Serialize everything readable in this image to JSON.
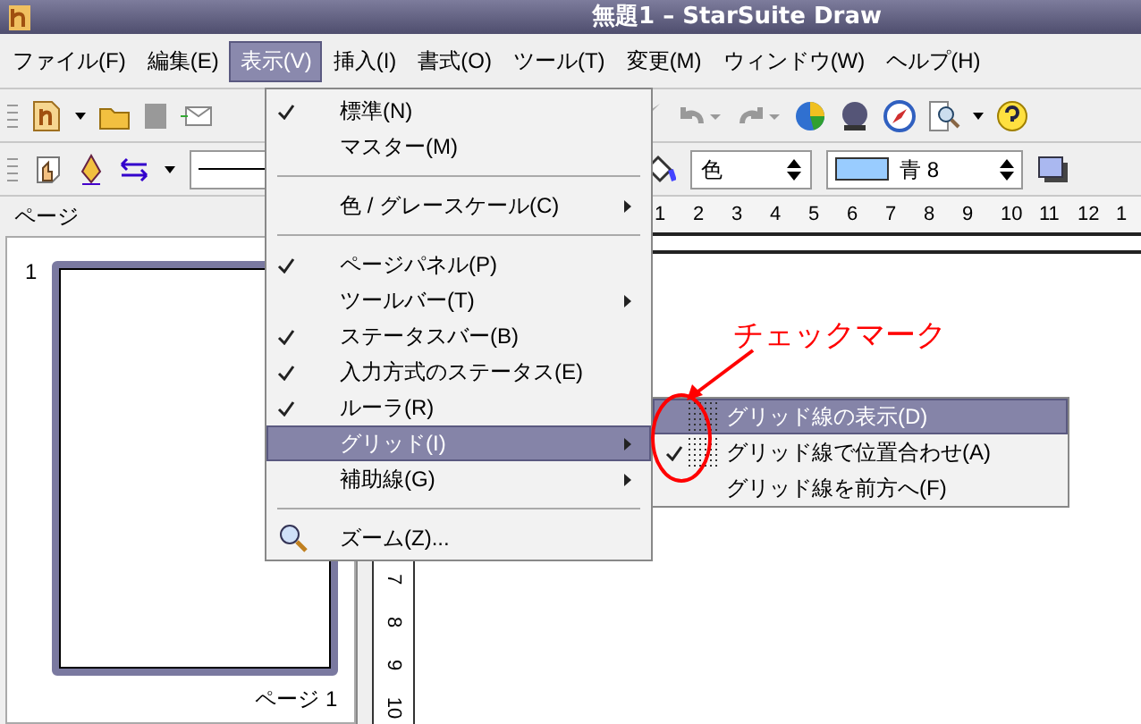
{
  "window": {
    "title": "無題1 – StarSuite Draw"
  },
  "menubar": [
    {
      "label": "ファイル(F)",
      "selected": false
    },
    {
      "label": "編集(E)",
      "selected": false
    },
    {
      "label": "表示(V)",
      "selected": true
    },
    {
      "label": "挿入(I)",
      "selected": false
    },
    {
      "label": "書式(O)",
      "selected": false
    },
    {
      "label": "ツール(T)",
      "selected": false
    },
    {
      "label": "変更(M)",
      "selected": false
    },
    {
      "label": "ウィンドウ(W)",
      "selected": false
    },
    {
      "label": "ヘルプ(H)",
      "selected": false
    }
  ],
  "line_properties": {
    "area_style": "色",
    "fill_color": {
      "label": "青 8",
      "color": "#99ccff"
    }
  },
  "ruler": {
    "horizontal": [
      "1",
      "2",
      "3",
      "4",
      "5",
      "6",
      "7",
      "8",
      "9",
      "10",
      "11",
      "12",
      "1"
    ],
    "vertical": [
      "7",
      "8",
      "9",
      "10"
    ]
  },
  "pages_panel": {
    "title": "ページ",
    "pages": [
      {
        "number": "1",
        "caption": "ページ 1",
        "selected": true
      }
    ]
  },
  "view_menu": [
    {
      "kind": "item",
      "label": "標準(N)",
      "checked": true,
      "submenu": false,
      "selected": false
    },
    {
      "kind": "item",
      "label": "マスター(M)",
      "checked": false,
      "submenu": false,
      "selected": false
    },
    {
      "kind": "separator"
    },
    {
      "kind": "item",
      "label": "色 / グレースケール(C)",
      "checked": false,
      "submenu": true,
      "selected": false
    },
    {
      "kind": "separator"
    },
    {
      "kind": "item",
      "label": "ページパネル(P)",
      "checked": true,
      "submenu": false,
      "selected": false
    },
    {
      "kind": "item",
      "label": "ツールバー(T)",
      "checked": false,
      "submenu": true,
      "selected": false
    },
    {
      "kind": "item",
      "label": "ステータスバー(B)",
      "checked": true,
      "submenu": false,
      "selected": false
    },
    {
      "kind": "item",
      "label": "入力方式のステータス(E)",
      "checked": true,
      "submenu": false,
      "selected": false
    },
    {
      "kind": "item",
      "label": "ルーラ(R)",
      "checked": true,
      "submenu": false,
      "selected": false
    },
    {
      "kind": "item",
      "label": "グリッド(I)",
      "checked": false,
      "submenu": true,
      "selected": true
    },
    {
      "kind": "item",
      "label": "補助線(G)",
      "checked": false,
      "submenu": true,
      "selected": false
    },
    {
      "kind": "separator"
    },
    {
      "kind": "zoom",
      "label": "ズーム(Z)...",
      "submenu": false,
      "selected": false
    }
  ],
  "grid_submenu": [
    {
      "label": "グリッド線の表示(D)",
      "checked": false,
      "selected": true
    },
    {
      "label": "グリッド線で位置合わせ(A)",
      "checked": true,
      "selected": false
    },
    {
      "label": "グリッド線を前方へ(F)",
      "checked": false,
      "selected": false
    }
  ],
  "annotation": {
    "text": "チェックマーク"
  }
}
